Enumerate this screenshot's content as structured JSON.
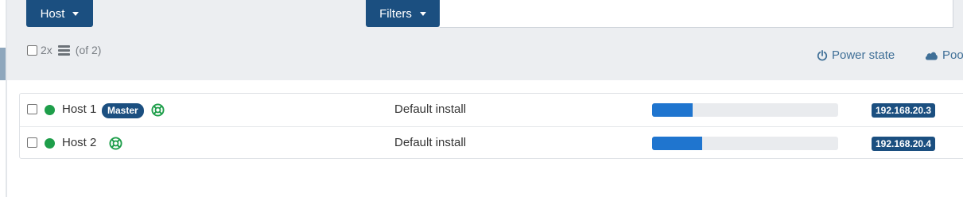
{
  "toolbar": {
    "host_button_label": "Host",
    "filters_button_label": "Filters",
    "filter_value": "",
    "selection": {
      "count_text": "2x",
      "total_text": "(of 2)"
    },
    "sort": [
      {
        "label": "Power state",
        "icon": "power-icon"
      },
      {
        "label": "Pool",
        "icon": "cloud-icon"
      }
    ]
  },
  "hosts": [
    {
      "name": "Host 1",
      "status_color": "#1e9e4a",
      "master_badge": "Master",
      "description": "Default install",
      "memory_usage": 0.22,
      "ip": "192.168.20.3"
    },
    {
      "name": "Host 2",
      "status_color": "#1e9e4a",
      "master_badge": null,
      "description": "Default install",
      "memory_usage": 0.27,
      "ip": "192.168.20.4"
    }
  ],
  "colors": {
    "accent": "#1b4f80",
    "running": "#1e9e4a",
    "bar_fill": "#1f75cf"
  }
}
